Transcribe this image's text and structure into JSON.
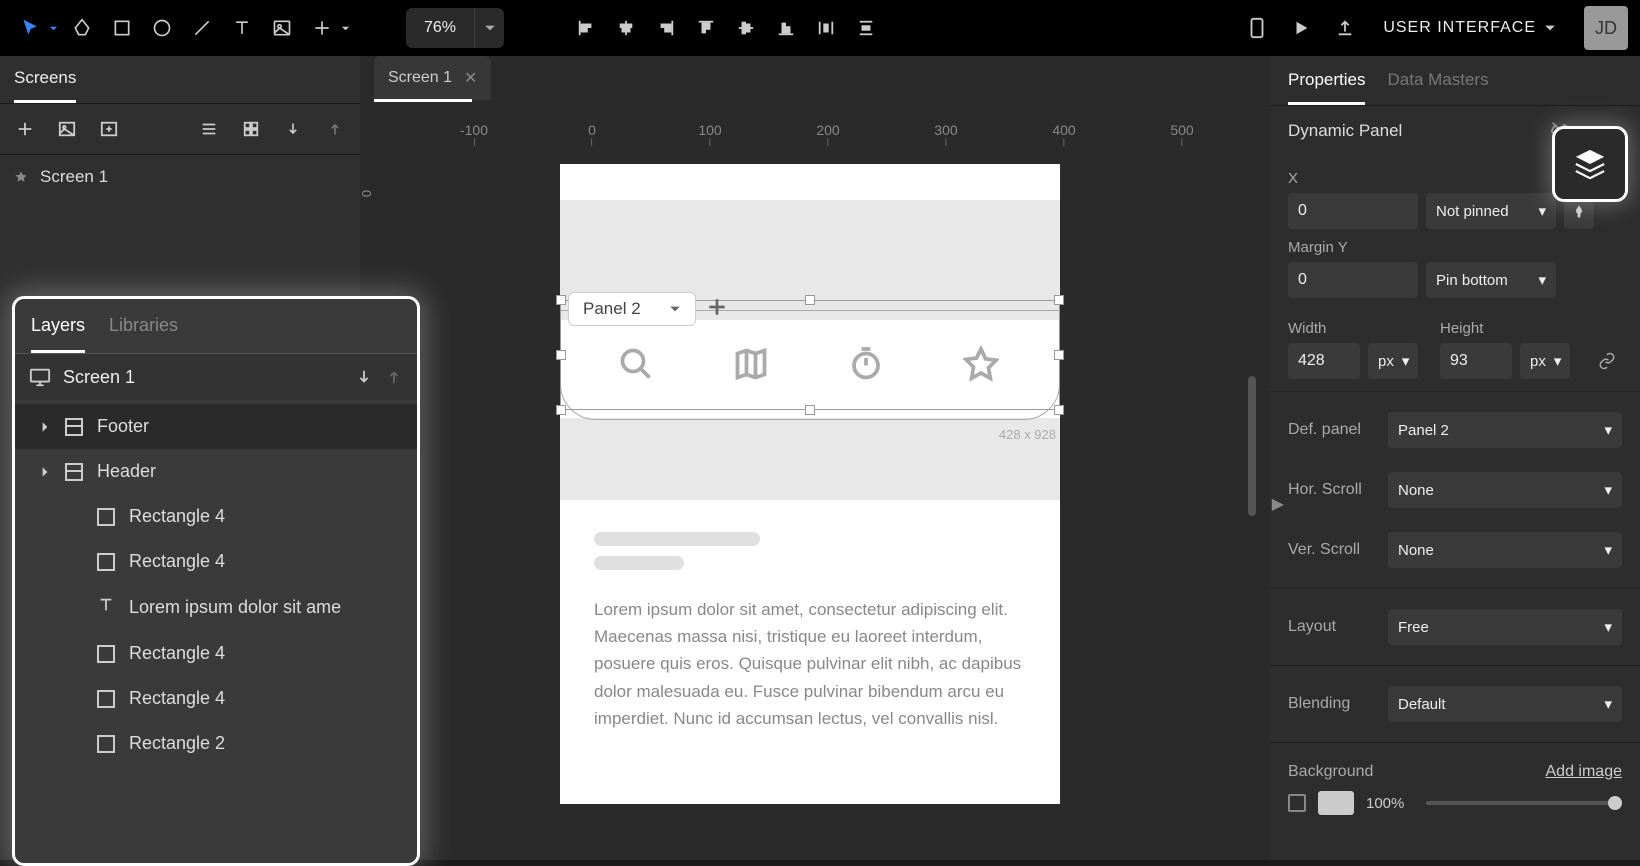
{
  "topbar": {
    "zoom": "76%",
    "profile_menu": "USER INTERFACE",
    "user_initials": "JD"
  },
  "left_panel": {
    "screens_tab": "Screens",
    "screen_item": "Screen 1"
  },
  "layers_popup": {
    "tab_layers": "Layers",
    "tab_libraries": "Libraries",
    "root": "Screen 1",
    "items": [
      {
        "label": "Footer",
        "type": "panel",
        "expandable": true,
        "selected": true
      },
      {
        "label": "Header",
        "type": "panel",
        "expandable": true
      },
      {
        "label": "Rectangle 4",
        "type": "rect"
      },
      {
        "label": "Rectangle 4",
        "type": "rect"
      },
      {
        "label": "Lorem ipsum dolor sit ame",
        "type": "text"
      },
      {
        "label": "Rectangle 4",
        "type": "rect"
      },
      {
        "label": "Rectangle 4",
        "type": "rect"
      },
      {
        "label": "Rectangle 2",
        "type": "rect"
      }
    ]
  },
  "doc_tab": "Screen 1",
  "ruler_h": [
    "-100",
    "0",
    "100",
    "200",
    "300",
    "400",
    "500"
  ],
  "canvas": {
    "panel_selector": "Panel 2",
    "selection_dims": "428 x 928",
    "body_text": "Lorem ipsum dolor sit amet, consectetur adipiscing elit. Maecenas massa nisi, tristique eu laoreet interdum, posuere quis eros. Quisque pulvinar elit nibh, ac dapibus dolor malesuada eu. Fusce pulvinar bibendum arcu eu imperdiet. Nunc id accumsan lectus, vel convallis nisl."
  },
  "right_panel": {
    "tab_props": "Properties",
    "tab_data": "Data Masters",
    "element_type": "Dynamic Panel",
    "x_label": "X",
    "x_value": "0",
    "pinned": "Not pinned",
    "margin_label": "Margin Y",
    "margin_value": "0",
    "pin_bottom": "Pin bottom",
    "width_label": "Width",
    "width_value": "428",
    "width_unit": "px",
    "height_label": "Height",
    "height_value": "93",
    "height_unit": "px",
    "def_panel_label": "Def. panel",
    "def_panel_value": "Panel 2",
    "hor_scroll_label": "Hor. Scroll",
    "hor_scroll_value": "None",
    "ver_scroll_label": "Ver. Scroll",
    "ver_scroll_value": "None",
    "layout_label": "Layout",
    "layout_value": "Free",
    "blending_label": "Blending",
    "blending_value": "Default",
    "background_label": "Background",
    "add_image": "Add image",
    "opacity": "100%"
  }
}
